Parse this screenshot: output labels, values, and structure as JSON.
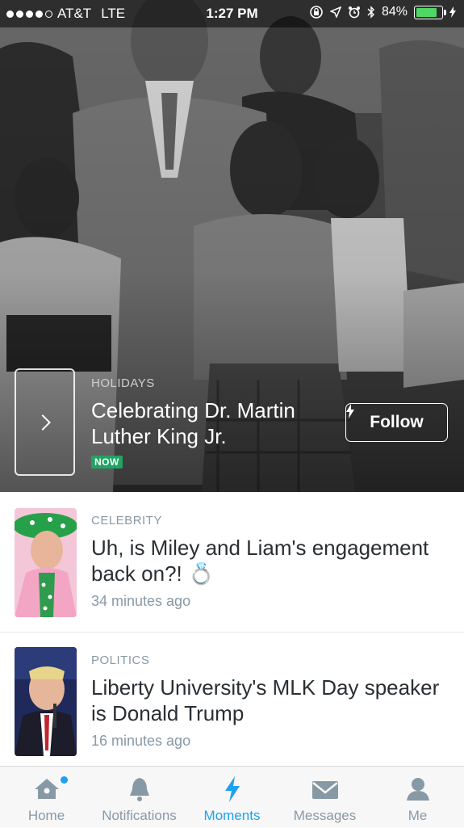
{
  "status_bar": {
    "carrier": "AT&T",
    "network": "LTE",
    "time": "1:27 PM",
    "battery": "84%",
    "battery_level": 0.84
  },
  "hero": {
    "category": "HOLIDAYS",
    "title": "Celebrating Dr. Martin Luther King Jr.",
    "badge": "NOW",
    "follow_label": "Follow"
  },
  "feed": [
    {
      "category": "CELEBRITY",
      "title": "Uh, is Miley and Liam's engagement back on?! 💍",
      "time": "34 minutes ago"
    },
    {
      "category": "POLITICS",
      "title": "Liberty University's MLK Day speaker is Donald Trump",
      "time": "16 minutes ago"
    }
  ],
  "tabs": [
    {
      "label": "Home",
      "icon": "home-icon"
    },
    {
      "label": "Notifications",
      "icon": "bell-icon"
    },
    {
      "label": "Moments",
      "icon": "lightning-icon",
      "active": true
    },
    {
      "label": "Messages",
      "icon": "envelope-icon"
    },
    {
      "label": "Me",
      "icon": "person-icon"
    }
  ],
  "colors": {
    "accent": "#1da1f2",
    "now_badge": "#1fa463",
    "text_primary": "#292f33",
    "text_secondary": "#8899a6"
  }
}
